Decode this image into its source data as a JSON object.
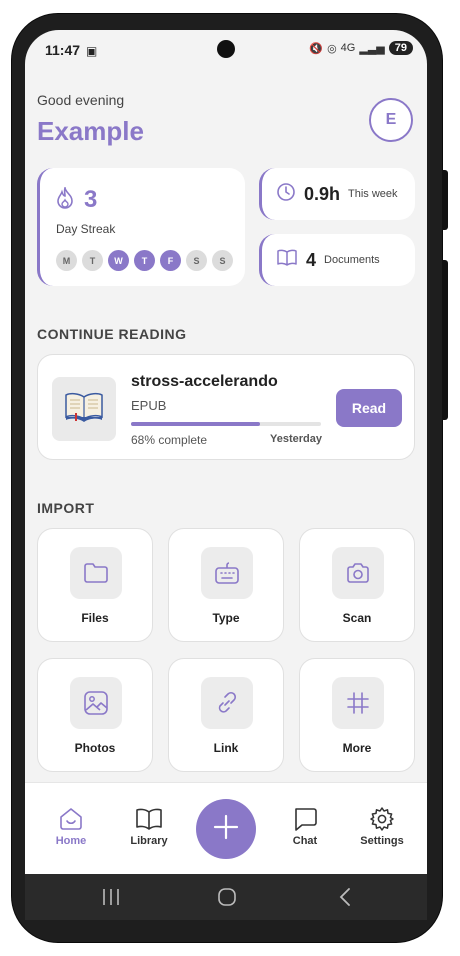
{
  "status": {
    "time": "11:47",
    "battery": "79",
    "network": "4G"
  },
  "header": {
    "greeting": "Good evening",
    "name": "Example",
    "avatar_initial": "E"
  },
  "streak": {
    "count": "3",
    "label": "Day Streak",
    "days": [
      {
        "letter": "M",
        "active": false
      },
      {
        "letter": "T",
        "active": false
      },
      {
        "letter": "W",
        "active": true
      },
      {
        "letter": "T",
        "active": true
      },
      {
        "letter": "F",
        "active": true
      },
      {
        "letter": "S",
        "active": false
      },
      {
        "letter": "S",
        "active": false
      }
    ]
  },
  "stats": {
    "time": {
      "value": "0.9h",
      "label": "This week",
      "icon": "clock-icon"
    },
    "docs": {
      "value": "4",
      "label": "Documents",
      "icon": "book-icon"
    }
  },
  "continue_reading": {
    "title": "CONTINUE READING",
    "book": {
      "title": "stross-accelerando",
      "format": "EPUB",
      "progress_percent": 68,
      "progress_text": "68% complete",
      "last_read": "Yesterday",
      "button_label": "Read"
    }
  },
  "import": {
    "title": "IMPORT",
    "tiles": [
      {
        "label": "Files",
        "icon": "folder-icon"
      },
      {
        "label": "Type",
        "icon": "keyboard-icon"
      },
      {
        "label": "Scan",
        "icon": "camera-icon"
      },
      {
        "label": "Photos",
        "icon": "image-icon"
      },
      {
        "label": "Link",
        "icon": "link-icon"
      },
      {
        "label": "More",
        "icon": "hash-icon"
      }
    ]
  },
  "bottom_nav": {
    "items": [
      {
        "label": "Home",
        "icon": "home-icon",
        "active": true
      },
      {
        "label": "Library",
        "icon": "book-open-icon",
        "active": false
      },
      {
        "label": "Chat",
        "icon": "chat-icon",
        "active": false
      },
      {
        "label": "Settings",
        "icon": "gear-icon",
        "active": false
      }
    ],
    "fab_icon": "plus-icon"
  },
  "colors": {
    "accent": "#8a78c8",
    "background": "#f3f3f3"
  }
}
